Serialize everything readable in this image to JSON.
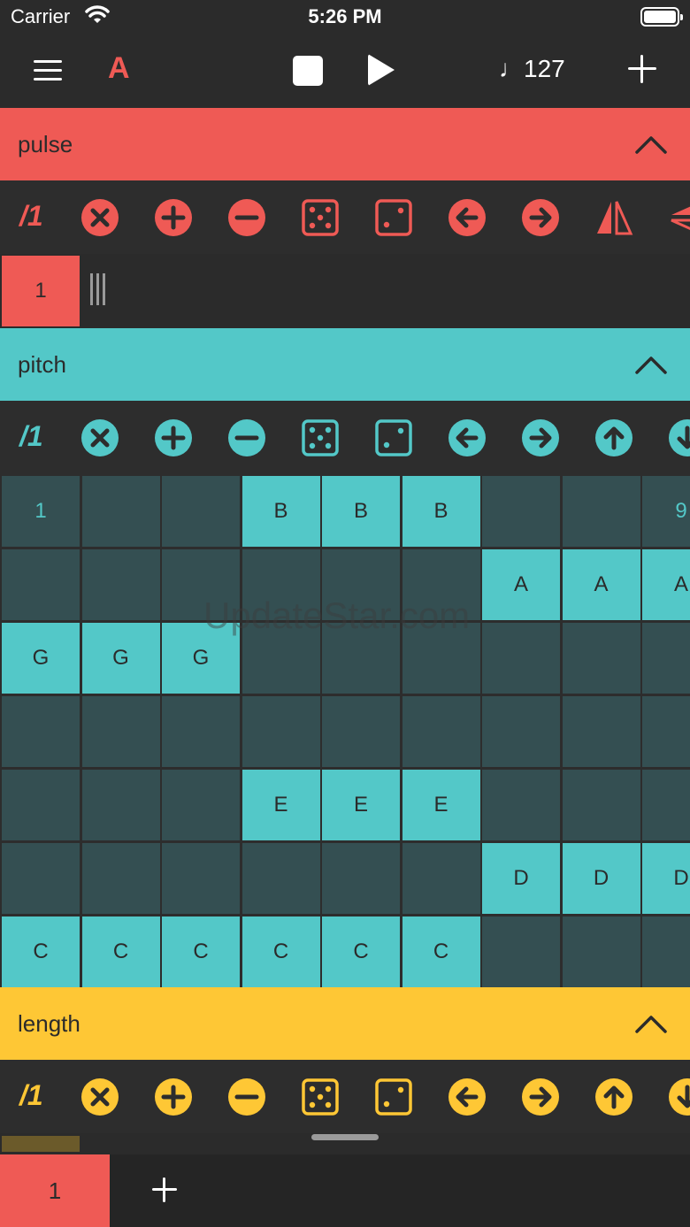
{
  "status_bar": {
    "carrier": "Carrier",
    "time": "5:26 PM"
  },
  "toolbar": {
    "pattern": "A",
    "tempo": "♩127"
  },
  "tracks": [
    {
      "name": "pulse",
      "divider": "/1",
      "color": "#ef5a55"
    },
    {
      "name": "pitch",
      "divider": "/1",
      "color": "#53c8c8"
    },
    {
      "name": "length",
      "divider": "/1",
      "color": "#fec735"
    }
  ],
  "pulse_row": {
    "step_label": "1"
  },
  "pitch_grid": {
    "rows": [
      [
        "1",
        "",
        "",
        "B",
        "B",
        "B",
        "",
        "",
        "9"
      ],
      [
        "",
        "",
        "",
        "",
        "",
        "",
        "A",
        "A",
        "A"
      ],
      [
        "G",
        "G",
        "G",
        "",
        "",
        "",
        "",
        "",
        ""
      ],
      [
        "",
        "",
        "",
        "",
        "",
        "",
        "",
        "",
        ""
      ],
      [
        "",
        "",
        "",
        "E",
        "E",
        "E",
        "",
        "",
        ""
      ],
      [
        "",
        "",
        "",
        "",
        "",
        "",
        "D",
        "D",
        "D"
      ],
      [
        "C",
        "C",
        "C",
        "C",
        "C",
        "C",
        "",
        "",
        ""
      ]
    ]
  },
  "watermark": "UpdateStar.com",
  "tabbar": {
    "pattern_label": "1"
  },
  "tools": [
    "clear-icon",
    "add-icon",
    "remove-icon",
    "randomize-icon",
    "randomize-single-icon",
    "shift-left-icon",
    "shift-right-icon",
    "mirror-icon",
    "flip-icon"
  ]
}
